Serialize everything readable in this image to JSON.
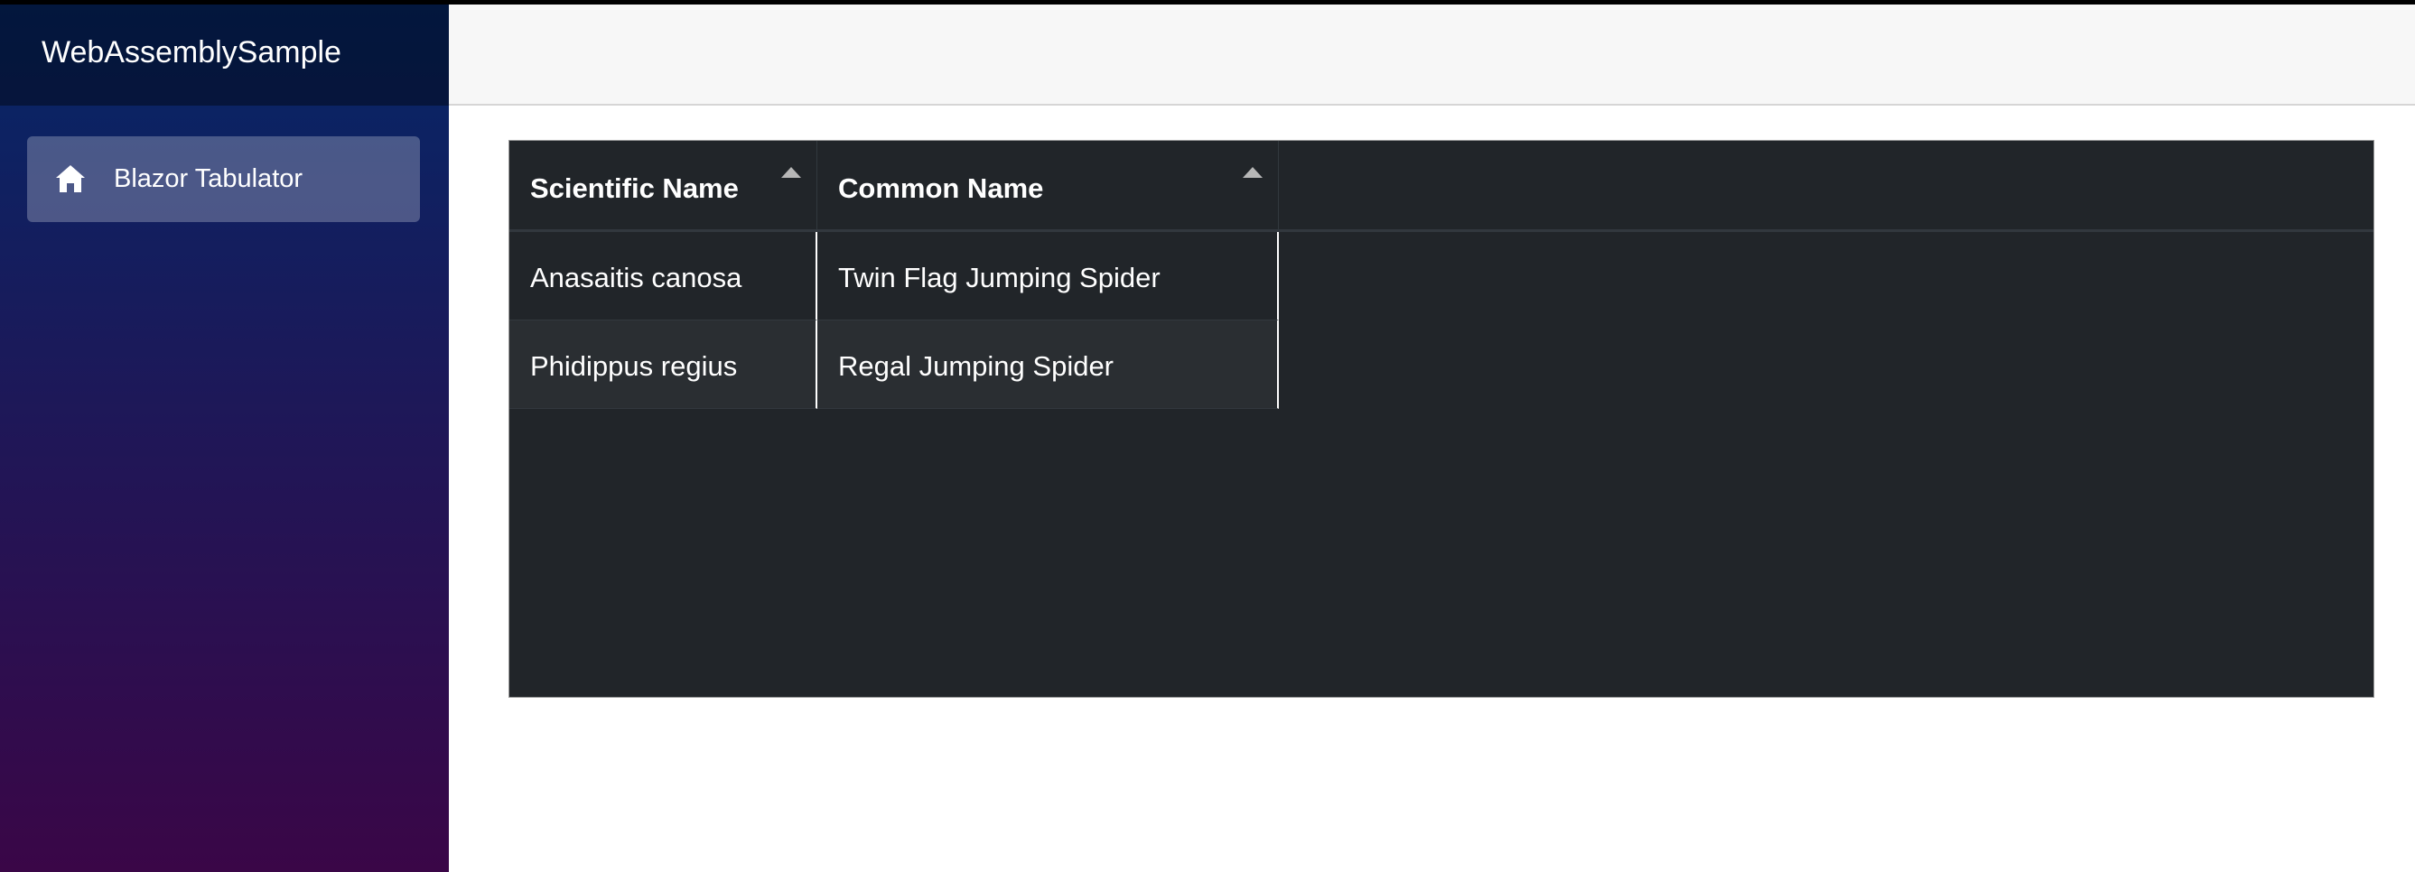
{
  "app": {
    "title": "WebAssemblySample"
  },
  "sidebar": {
    "items": [
      {
        "label": "Blazor Tabulator",
        "icon": "home-icon"
      }
    ]
  },
  "table": {
    "columns": [
      {
        "title": "Scientific Name",
        "sort": "ascending"
      },
      {
        "title": "Common Name",
        "sort": "ascending"
      }
    ],
    "rows": [
      {
        "scientific_name": "Anasaitis canosa",
        "common_name": "Twin Flag Jumping Spider"
      },
      {
        "scientific_name": "Phidippus regius",
        "common_name": "Regal Jumping Spider"
      }
    ]
  },
  "colors": {
    "sidebar_top": "#052767",
    "sidebar_bottom": "#3a0647",
    "table_background": "#212529",
    "table_row_alt": "#2a2e32"
  }
}
